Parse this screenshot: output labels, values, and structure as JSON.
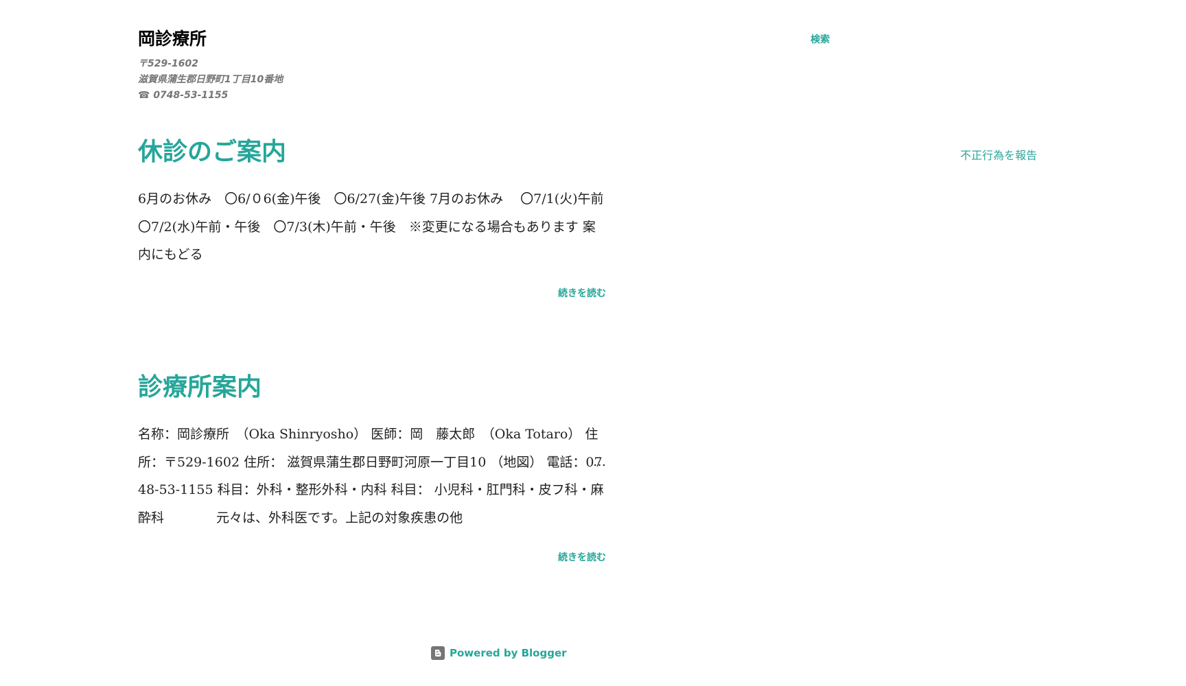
{
  "header": {
    "title": "岡診療所",
    "description_lines": [
      "〒529-1602",
      "滋賀県蒲生郡日野町1丁目10番地",
      "☎ 0748-53-1155"
    ],
    "search_label": "検索"
  },
  "sidebar": {
    "report_abuse_label": "不正行為を報告"
  },
  "posts": [
    {
      "title": "休診のご案内",
      "snippet": "6月のお休み　〇6/０6(金)午後　〇6/27(金)午後 7月のお休み　 〇7/1(火)午前　〇7/2(水)午前・午後　〇7/3(木)午前・午後　※変更になる場合もあります 案内にもどる",
      "read_more": "続きを読む"
    },
    {
      "title": "診療所案内",
      "snippet": "名称：岡診療所　（Oka Shinryosho） 医師：岡　藤太郎　（Oka Totaro） 住所：〒529-1602 住所： 滋賀県蒲生郡日野町河原一丁目10 （地図） 電話：0748-53-1155 科目：外科・整形外科・内科 科目： 小児科・肛門科・皮フ科・麻酔科　　　　元々は、外科医です。上記の対象疾患の他",
      "ellipsis": "…",
      "read_more": "続きを読む"
    }
  ],
  "footer": {
    "powered_by": "Powered by Blogger",
    "icon": "blogger-icon"
  },
  "colors": {
    "accent": "#26a69a",
    "title_text": "#000000",
    "description_text": "#757575",
    "body_text": "#212121",
    "background": "#ffffff"
  }
}
